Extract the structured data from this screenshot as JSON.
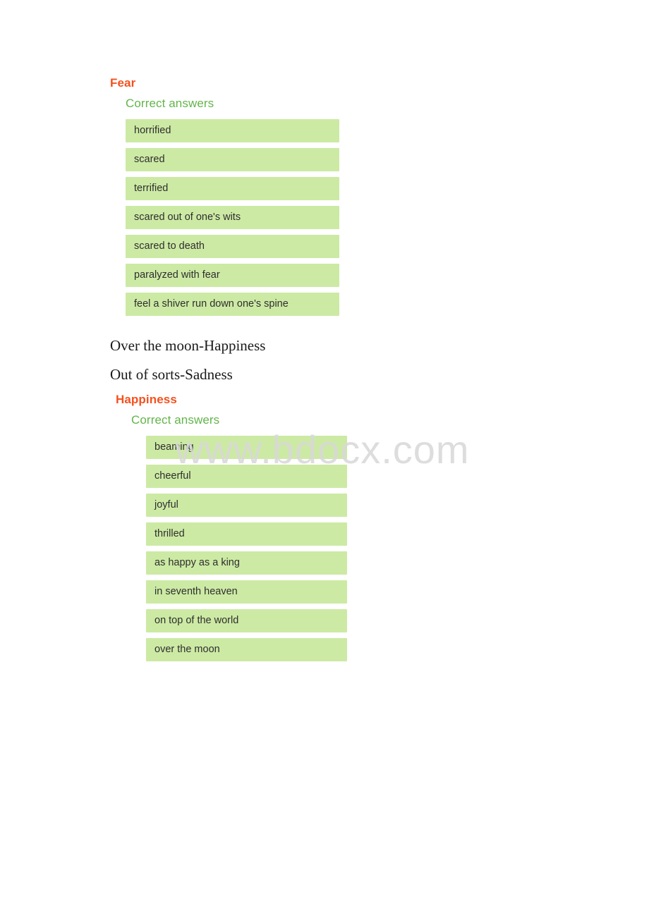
{
  "watermark": {
    "text": "www.bdocx.com"
  },
  "blocks": [
    {
      "title": "Fear",
      "subtitle": "Correct answers",
      "answers": [
        "horrified",
        "scared",
        "terrified",
        "scared out of one's wits",
        "scared to death",
        "paralyzed with fear",
        "feel a shiver run down one's spine"
      ]
    },
    {
      "title": "Happiness",
      "subtitle": "Correct answers",
      "answers": [
        "beaming",
        "cheerful",
        "joyful",
        "thrilled",
        "as happy as a king",
        "in seventh heaven",
        "on top of the world",
        "over the moon"
      ]
    }
  ],
  "paragraphs": [
    "Over the moon-Happiness",
    "Out of sorts-Sadness"
  ],
  "colors": {
    "title": "#f4511e",
    "subtitle": "#63b54a",
    "answer_background": "#cdeaa5",
    "answer_text": "#2e2e2e",
    "watermark": "#d8d8d8",
    "page_background": "#ffffff"
  }
}
